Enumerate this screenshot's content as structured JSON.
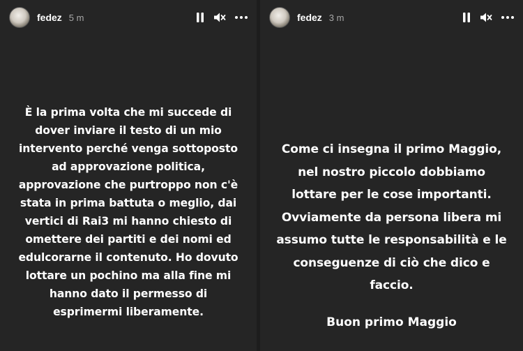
{
  "stories": [
    {
      "username": "fedez",
      "time": "5 m",
      "lines": [
        "È la prima volta che mi succede di",
        "dover inviare il testo di un mio",
        "intervento perché venga sottoposto",
        "ad approvazione politica,",
        "approvazione che purtroppo non c'è",
        "stata in prima battuta o meglio, dai",
        "vertici di Rai3 mi hanno chiesto di",
        "omettere dei partiti e dei nomi ed",
        "edulcorarne il contenuto. Ho dovuto",
        "lottare un pochino ma alla fine mi",
        "hanno dato il permesso di",
        "esprimermi liberamente."
      ]
    },
    {
      "username": "fedez",
      "time": "3 m",
      "lines": [
        "Come ci insegna il primo Maggio,",
        "nel nostro piccolo dobbiamo",
        "lottare per le cose importanti.",
        "Ovviamente da persona libera mi",
        "assumo tutte le responsabilità e le",
        "conseguenze di ciò che dico e",
        "faccio."
      ],
      "closing": "Buon primo Maggio"
    }
  ],
  "icons": {
    "pause": "pause-icon",
    "mute": "speaker-muted-icon",
    "more": "more-horizontal-icon"
  },
  "colors": {
    "background": "#252525",
    "text": "#ffffff",
    "time": "#a8a8a8"
  }
}
